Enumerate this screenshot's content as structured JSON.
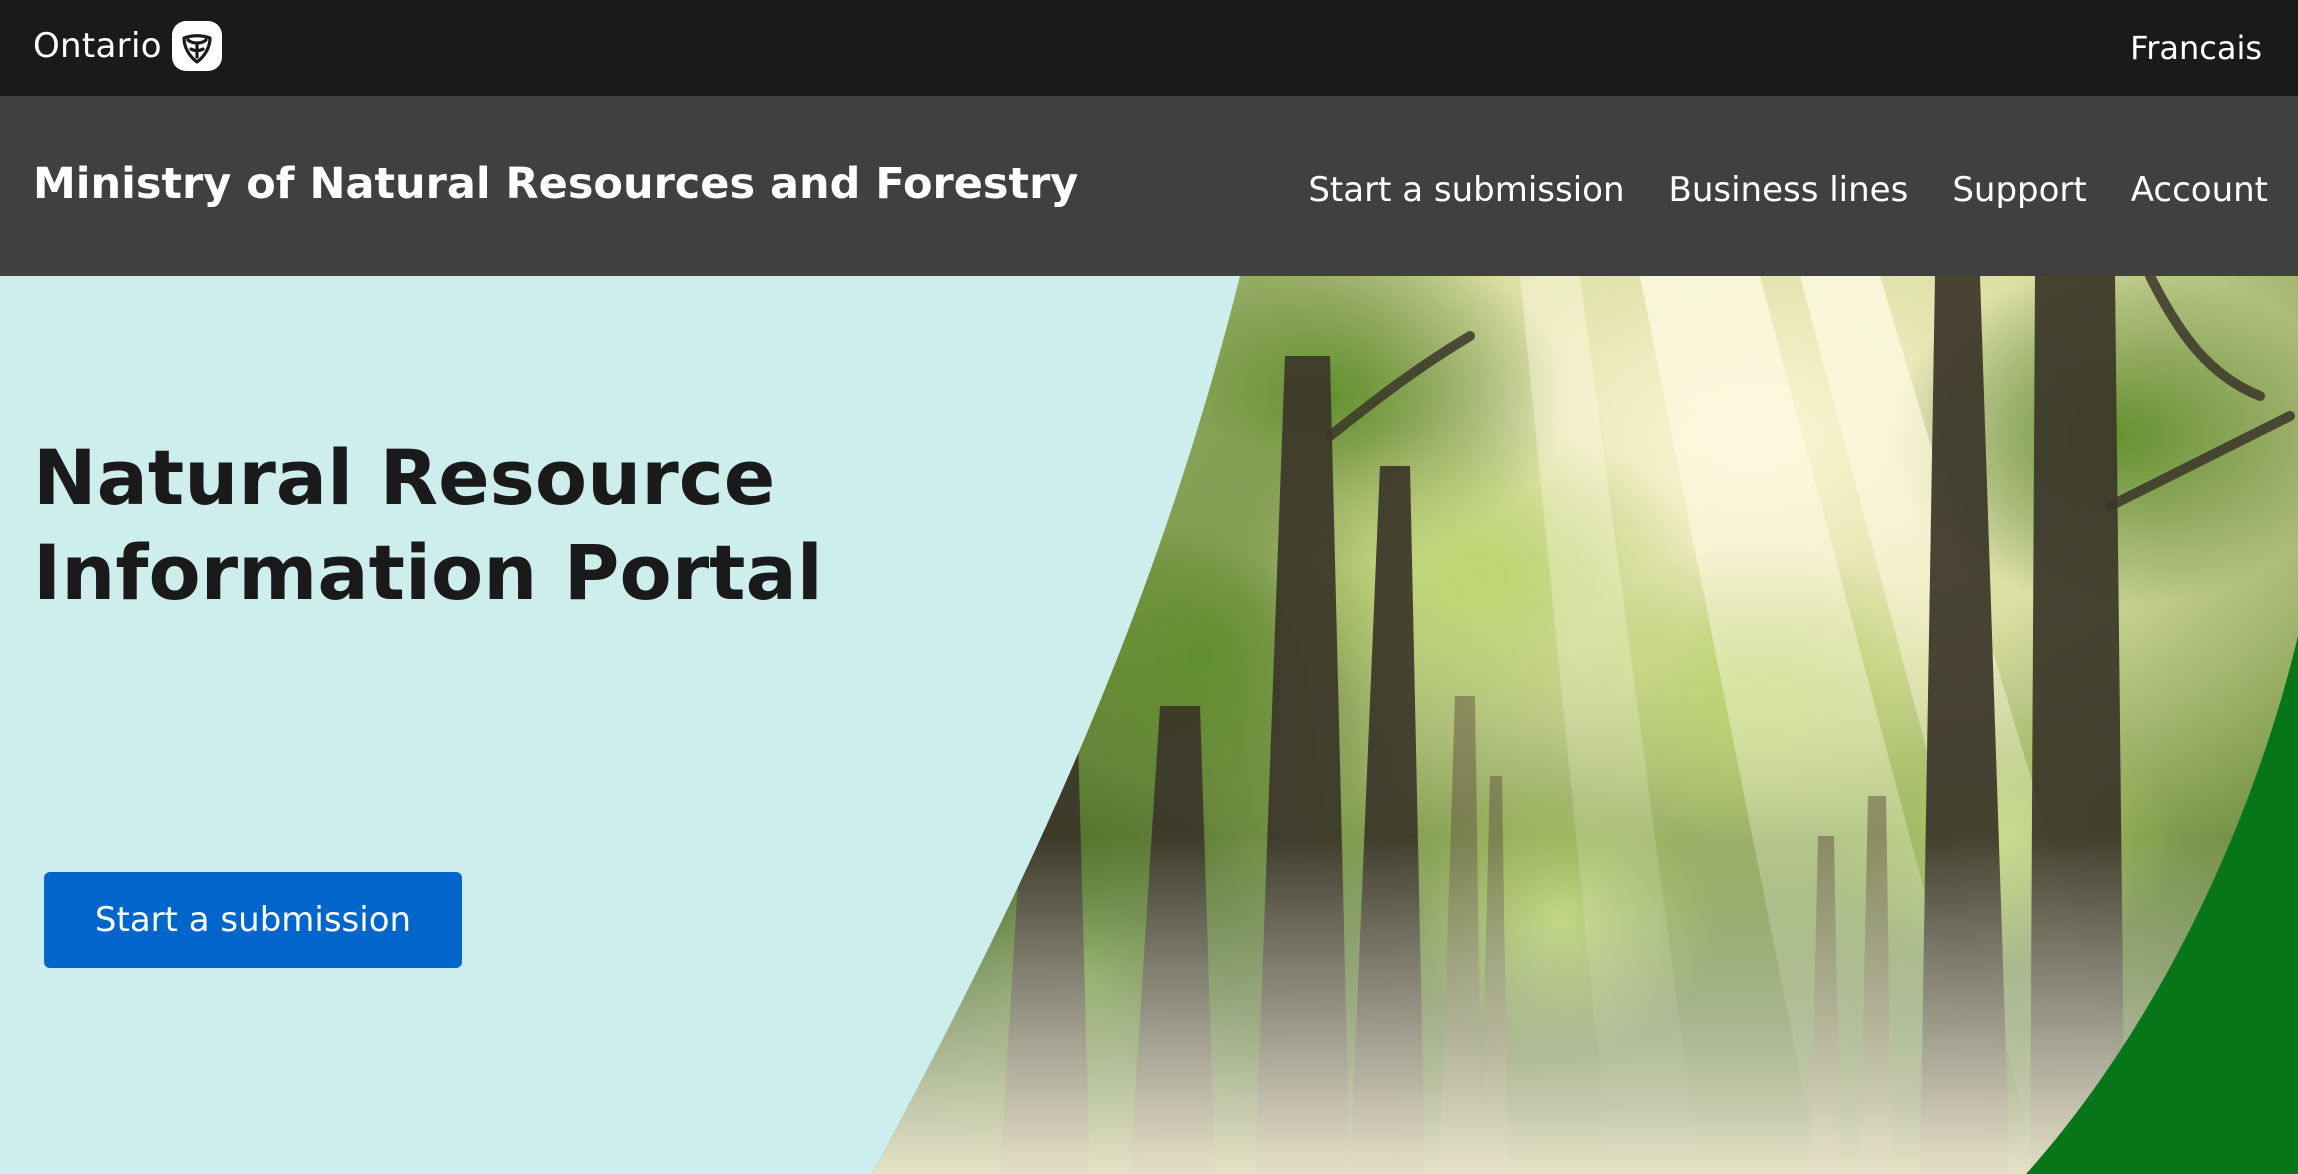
{
  "header": {
    "logo_text": "Ontario",
    "language_link": "Francais"
  },
  "nav": {
    "ministry_title": "Ministry of Natural Resources and Forestry",
    "items": [
      {
        "label": "Start a submission"
      },
      {
        "label": "Business lines"
      },
      {
        "label": "Support"
      },
      {
        "label": "Account"
      }
    ]
  },
  "hero": {
    "title": "Natural Resource Information Portal",
    "cta_label": "Start a submission",
    "image": "forest-photo"
  },
  "colors": {
    "topbar": "#1a1a1a",
    "navbar": "#404040",
    "hero_background": "#cdeeed",
    "accent_green": "#077619",
    "button_blue": "#0066cc"
  },
  "icons": {
    "logo": "ontario-trillium-icon"
  }
}
